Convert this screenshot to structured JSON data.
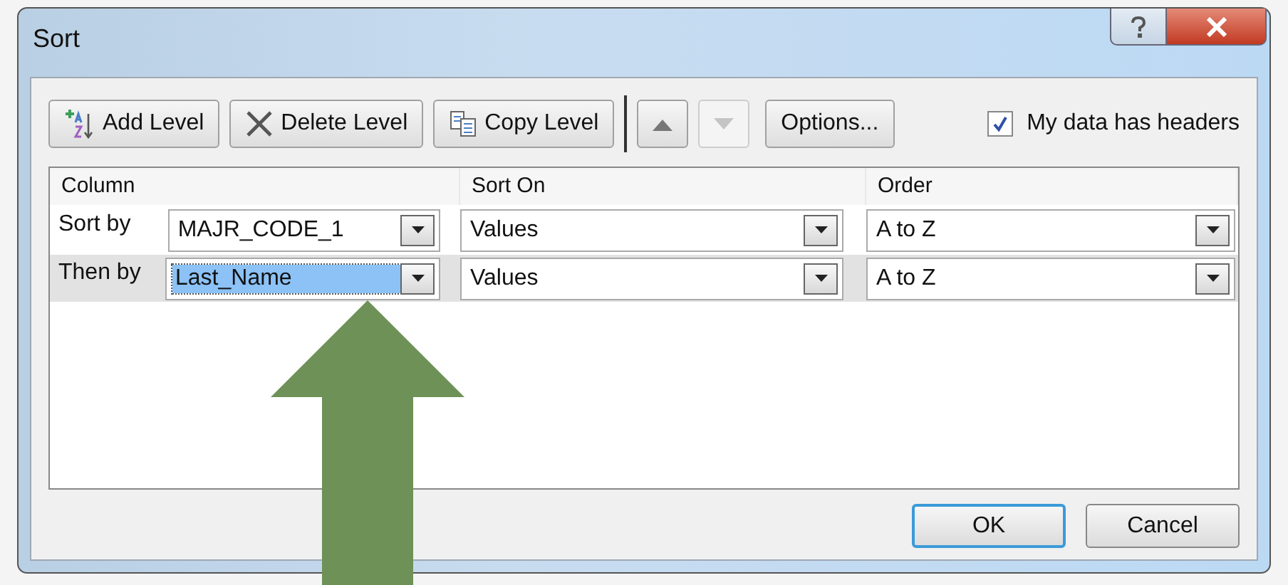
{
  "window": {
    "title": "Sort"
  },
  "toolbar": [
    {
      "kind": "add",
      "label": "Add Level",
      "disabled": false
    },
    {
      "kind": "delete",
      "label": "Delete Level",
      "disabled": false
    },
    {
      "kind": "copy",
      "label": "Copy Level",
      "disabled": false
    },
    {
      "kind": "up",
      "disabled": false
    },
    {
      "kind": "down",
      "disabled": true
    },
    {
      "kind": "options",
      "label": "Options...",
      "disabled": false
    }
  ],
  "headers_checkbox": {
    "label": "My data has headers",
    "checked": true
  },
  "table": {
    "columns": [
      "Column",
      "Sort On",
      "Order"
    ],
    "rows": [
      {
        "label": "Sort by",
        "column": "MAJR_CODE_1",
        "sort_on": "Values",
        "order": "A to Z",
        "selected": false
      },
      {
        "label": "Then by",
        "column": "Last_Name",
        "sort_on": "Values",
        "order": "A to Z",
        "selected": true
      }
    ]
  },
  "buttons": [
    {
      "label": "OK",
      "default": true
    },
    {
      "label": "Cancel",
      "default": false
    }
  ]
}
